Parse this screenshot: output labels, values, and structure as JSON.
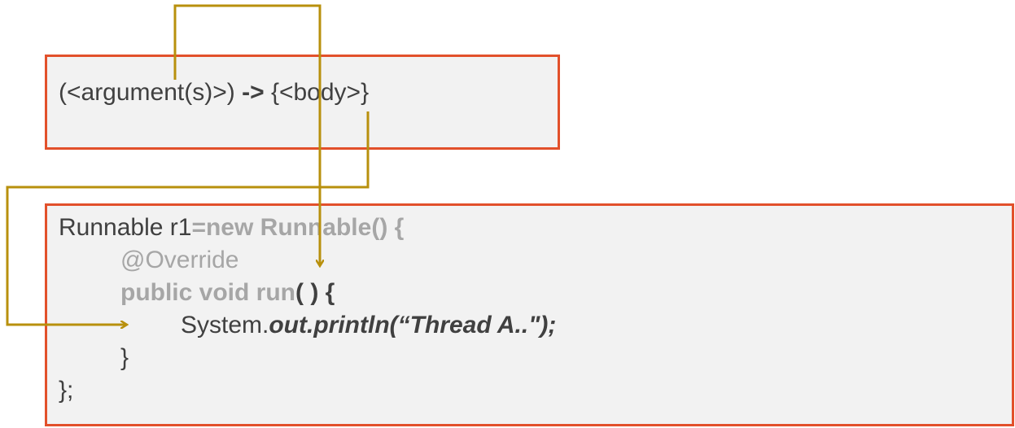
{
  "colors": {
    "box_border": "#e2502b",
    "box_fill": "#f2f2f2",
    "arrow": "#b8900d",
    "text_dark": "#404040",
    "text_grey": "#a6a6a6"
  },
  "syntax": {
    "args": "(<argument(s)>)",
    "arrow": "->",
    "body": "{<body>}"
  },
  "code": {
    "l1_a": "Runnable r1",
    "l1_b": "=new Runnable() {",
    "l2": "@Override",
    "l3_a": "public void run",
    "l3_b": "( ) {",
    "l4_a": "System.",
    "l4_b": "out.println(“Thread A..\");",
    "l5": "}",
    "l6": "};"
  }
}
